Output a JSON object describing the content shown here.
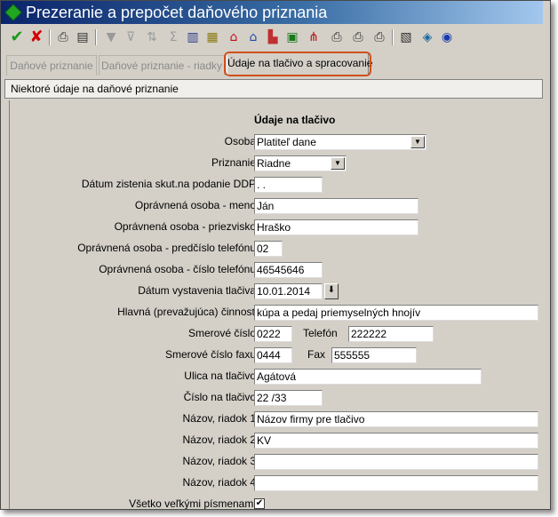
{
  "window": {
    "title": "Prezeranie a prepočet daňového priznania"
  },
  "toolbar": {
    "icons": [
      "check-icon",
      "close-icon",
      "print-icon",
      "document-icon",
      "filter-icon",
      "filter-clear-icon",
      "sort-icon",
      "sum-icon",
      "trash-icon",
      "calculator-icon",
      "house-red-icon",
      "house-blue-icon",
      "chart-icon",
      "table-icon",
      "tree-icon",
      "printer-icon",
      "printer-setup-icon",
      "printer-alt-icon",
      "notebook-icon",
      "cube-icon",
      "globe-icon"
    ]
  },
  "tabs": [
    {
      "label": "Daňové priznanie"
    },
    {
      "label": "Daňové priznanie - riadky"
    },
    {
      "label": "Údaje na tlačivo a spracovanie"
    }
  ],
  "section": {
    "title": "Niektoré údaje na daňové priznanie"
  },
  "form": {
    "heading": "Údaje na tlačivo",
    "osoba": {
      "label": "Osoba",
      "value": "Platiteľ dane"
    },
    "priznanie": {
      "label": "Priznanie",
      "value": "Riadne"
    },
    "datum_zistenia": {
      "label": "Dátum zistenia skut.na podanie DDP",
      "value": " .  ."
    },
    "meno": {
      "label": "Oprávnená osoba - meno",
      "value": "Ján"
    },
    "priezvisko": {
      "label": "Oprávnená osoba - priezvisko",
      "value": "Hraško"
    },
    "predcislo": {
      "label": "Oprávnená osoba - predčíslo telefónu",
      "value": "02"
    },
    "cislo_tel": {
      "label": "Oprávnená osoba - číslo telefónu",
      "value": "46545646"
    },
    "datum_vystavenia": {
      "label": "Dátum vystavenia tlačiva",
      "value": "10.01.2014"
    },
    "cinnost": {
      "label": "Hlavná (prevažujúca) činnosť",
      "value": "kúpa a pedaj priemyselných hnojív"
    },
    "smerove_cislo": {
      "label": "Smerové číslo",
      "value": "0222"
    },
    "telefon": {
      "label": "Telefón",
      "value": "222222"
    },
    "smerove_fax": {
      "label": "Smerové číslo faxu",
      "value": "0444"
    },
    "fax": {
      "label": "Fax",
      "value": "555555"
    },
    "ulica": {
      "label": "Ulica na tlačivo",
      "value": "Agátová"
    },
    "cislo": {
      "label": "Číslo na tlačivo",
      "value": "22 /33"
    },
    "nazov1": {
      "label": "Názov, riadok 1",
      "value": "Názov firmy  pre tlačivo"
    },
    "nazov2": {
      "label": "Názov, riadok 2",
      "value": "KV"
    },
    "nazov3": {
      "label": "Názov, riadok 3",
      "value": ""
    },
    "nazov4": {
      "label": "Názov, riadok 4",
      "value": ""
    },
    "velke_pismena": {
      "label": "Všetko veľkými písmenami",
      "checked": true
    }
  }
}
